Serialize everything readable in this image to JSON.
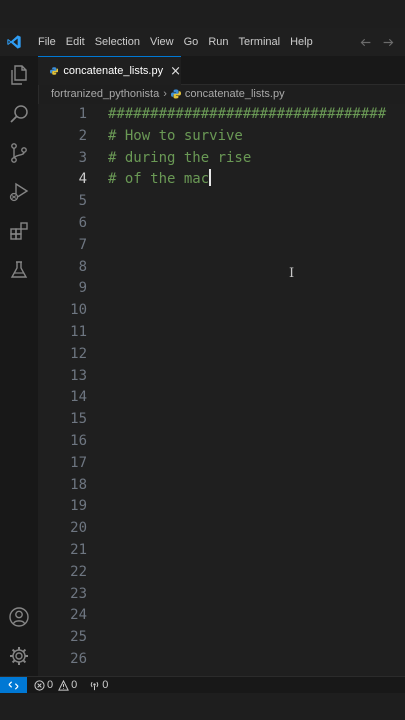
{
  "menu": {
    "logo_icon": "vscode-logo-icon",
    "items": [
      "File",
      "Edit",
      "Selection",
      "View",
      "Go",
      "Run",
      "Terminal",
      "Help"
    ],
    "back_icon": "arrow-left-icon",
    "forward_icon": "arrow-right-icon"
  },
  "activity_bar": {
    "top_icons": [
      "explorer-icon",
      "search-icon",
      "source-control-icon",
      "run-debug-icon",
      "extensions-icon",
      "testing-icon"
    ],
    "bottom_icons": [
      "account-icon",
      "manage-gear-icon"
    ]
  },
  "tab": {
    "label": "concatenate_lists.py",
    "close": "×"
  },
  "breadcrumb": {
    "folder": "fortranized_pythonista",
    "separator": "›",
    "file": "concatenate_lists.py"
  },
  "editor": {
    "active_line": 4,
    "line_numbers": [
      "1",
      "2",
      "3",
      "4",
      "5",
      "6",
      "7",
      "8",
      "9",
      "10",
      "11",
      "12",
      "13",
      "14",
      "15",
      "16",
      "17",
      "18",
      "19",
      "20",
      "21",
      "22",
      "23",
      "24",
      "25",
      "26"
    ],
    "code": [
      "#################################",
      "# How to survive",
      "# during the rise",
      "# of the mac"
    ]
  },
  "status_bar": {
    "remote_icon": "remote-icon",
    "errors": "0",
    "warnings": "0",
    "ports": "0",
    "colors": {
      "remote_bg": "#0078d4"
    }
  },
  "colors": {
    "comment": "#6a9955",
    "accent": "#0078d4",
    "editor_bg": "#1f1f1f"
  }
}
